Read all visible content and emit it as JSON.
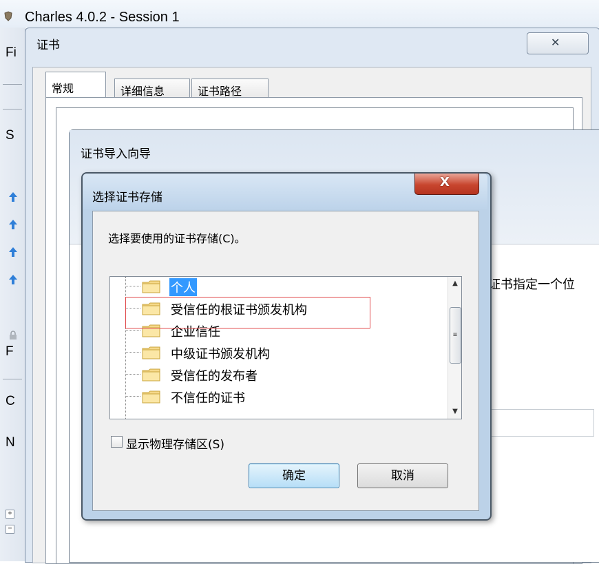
{
  "charles": {
    "title": "Charles 4.0.2 - Session 1",
    "side_labels": [
      "Fi",
      "S",
      "F",
      "C",
      "N"
    ],
    "tree_toggles": [
      "+",
      "−"
    ]
  },
  "cert_window": {
    "title": "证书",
    "close_glyph": "✕",
    "tabs": [
      {
        "label": "常规",
        "active": true
      },
      {
        "label": "详细信息",
        "active": false
      },
      {
        "label": "证书路径",
        "active": false
      }
    ]
  },
  "wizard": {
    "title": "证书导入向导",
    "partial_text": "证书指定一个位"
  },
  "store_dialog": {
    "title": "选择证书存储",
    "close_glyph": "X",
    "prompt": "选择要使用的证书存储(C)。",
    "stores": [
      {
        "label": "个人",
        "selected": true
      },
      {
        "label": "受信任的根证书颁发机构",
        "selected": false
      },
      {
        "label": "企业信任",
        "selected": false
      },
      {
        "label": "中级证书颁发机构",
        "selected": false
      },
      {
        "label": "受信任的发布者",
        "selected": false
      },
      {
        "label": "不信任的证书",
        "selected": false
      }
    ],
    "show_physical_label": "显示物理存储区(S)",
    "show_physical_checked": false,
    "ok_label": "确定",
    "cancel_label": "取消"
  },
  "colors": {
    "selection": "#3399ff",
    "highlight_box": "#e0484a",
    "close_button": "#c8452e"
  }
}
